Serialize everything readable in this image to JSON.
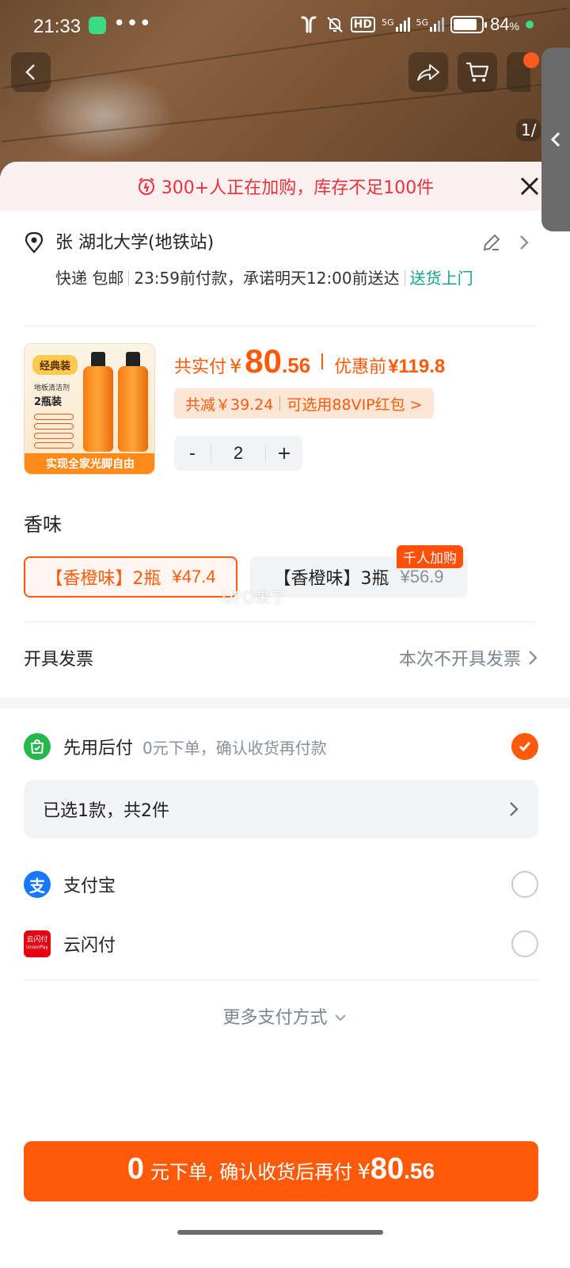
{
  "status_bar": {
    "time": "21:33",
    "dots": "•••",
    "hd": "HD",
    "net1": "5G",
    "net2": "5G",
    "battery_pct": "84",
    "battery_unit": "%",
    "battery_level": 0.84
  },
  "page_indicator": "1/",
  "alert": {
    "text": "300+人正在加购，库存不足100件"
  },
  "address": {
    "name_line": "张 湖北大学(地铁站)",
    "ship_method": "快递 包邮",
    "deadline": "23:59前付款，承诺明天12:00前送达",
    "door": "送货上门"
  },
  "product": {
    "image": {
      "tag": "经典装",
      "line1": "地板清洁剂",
      "line2": "2瓶装",
      "banner": "实现全家光脚自由"
    },
    "total_label": "共实付",
    "currency": "¥",
    "price_int": "80",
    "price_dec": ".56",
    "orig_label": "优惠前",
    "orig_price": "¥119.8",
    "savings": "共减￥39.24",
    "vip": "可选用88VIP红包 >",
    "quantity": "2",
    "minus": "-",
    "plus": "+"
  },
  "scent": {
    "title": "香味",
    "options": [
      {
        "label": "【香橙味】2瓶",
        "price": "¥47.4",
        "selected": true
      },
      {
        "label": "【香橙味】3瓶",
        "price": "¥56.9",
        "selected": false,
        "tag": "千人加购"
      }
    ]
  },
  "watermark": "UFO来了",
  "invoice": {
    "label": "开具发票",
    "value": "本次不开具发票"
  },
  "payment": {
    "later": {
      "label": "先用后付",
      "desc": "0元下单，确认收货再付款",
      "checked": true
    },
    "selected_summary": "已选1款，共2件",
    "alipay": {
      "label": "支付宝",
      "checked": false
    },
    "unionpay": {
      "label": "云闪付",
      "checked": false,
      "logo_text": "云闪付",
      "logo_sub": "UnionPay"
    },
    "more": "更多支付方式"
  },
  "cta": {
    "zero": "0",
    "text": "元下单, 确认收货后再付",
    "currency": "¥",
    "price_int": "80",
    "price_dec": ".56"
  },
  "colors": {
    "accent": "#ff5a0a",
    "alert": "#e8323c",
    "teal": "#14a38b"
  }
}
